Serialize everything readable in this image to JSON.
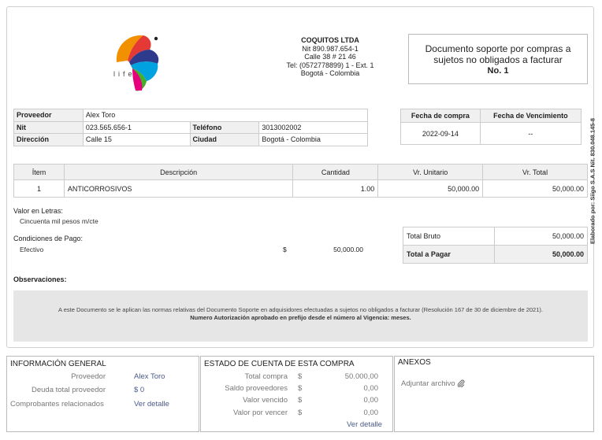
{
  "company": {
    "name": "COQUITOS LTDA",
    "nit": "Nit 890.987.654-1",
    "address": "Calle 38 # 21 46",
    "phone": "Tel: (0572778899) 1 - Ext. 1",
    "city": "Bogotá - Colombia",
    "logo_text": "life"
  },
  "document": {
    "title": "Documento soporte por compras a sujetos no obligados a facturar",
    "number": "No. 1"
  },
  "provider": {
    "name_label": "Proveedor",
    "name": "Alex Toro",
    "nit_label": "Nit",
    "nit": "023.565.656-1",
    "phone_label": "Teléfono",
    "phone": "3013002002",
    "address_label": "Dirección",
    "address": "Calle 15",
    "city_label": "Ciudad",
    "city": "Bogotá - Colombia"
  },
  "dates": {
    "purchase_label": "Fecha de compra",
    "purchase": "2022-09-14",
    "due_label": "Fecha de Vencimiento",
    "due": "--"
  },
  "items": {
    "headers": [
      "Ítem",
      "Descripción",
      "Cantidad",
      "Vr. Unitario",
      "Vr. Total"
    ],
    "rows": [
      {
        "item": "1",
        "description": "ANTICORROSIVOS",
        "quantity": "1.00",
        "unit": "50,000.00",
        "total": "50,000.00"
      }
    ]
  },
  "words": {
    "label": "Valor en Letras:",
    "value": "Cincuenta mil pesos m/cte"
  },
  "payment": {
    "label": "Condiciones de Pago:",
    "method": "Efectivo",
    "currency": "$",
    "amount": "50,000.00"
  },
  "totals": {
    "gross_label": "Total Bruto",
    "gross": "50,000.00",
    "pay_label": "Total a Pagar",
    "pay": "50,000.00"
  },
  "observations": {
    "label": "Observaciones:"
  },
  "legal": {
    "line1": "A este Documento se le aplican las normas relativas del Documento Soporte en adquisidores efectuadas a sujetos no obligados a facturar (Resolución 167 de 30 de diciembre de 2021).",
    "line2": "Numero Autorización aprobado en prefijo desde el número al Vigencia: meses."
  },
  "vertical_text": "Elaborado por: Siigo S.A.S Nit. 830.048.145-8",
  "general_info": {
    "title": "INFORMACIÓN GENERAL",
    "provider_label": "Proveedor",
    "provider": "Alex Toro",
    "debt_label": "Deuda total proveedor",
    "debt": "$ 0",
    "related_label": "Comprobantes relacionados",
    "related_link": "Ver detalle"
  },
  "account_status": {
    "title": "ESTADO DE CUENTA DE ESTA COMPRA",
    "rows": [
      {
        "label": "Total compra",
        "currency": "$",
        "value": "50.000,00"
      },
      {
        "label": "Saldo proveedores",
        "currency": "$",
        "value": "0,00"
      },
      {
        "label": "Valor vencido",
        "currency": "$",
        "value": "0,00"
      },
      {
        "label": "Valor por vencer",
        "currency": "$",
        "value": "0,00"
      }
    ],
    "link": "Ver detalle"
  },
  "annexes": {
    "title": "ANEXOS",
    "attach_label": "Adjuntar archivo",
    "attach_icon": "paperclip-icon"
  }
}
